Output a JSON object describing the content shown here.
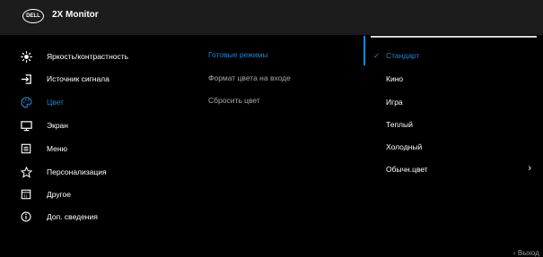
{
  "header": {
    "logo_text": "DELL",
    "title": "2X Monitor"
  },
  "menu": [
    {
      "label": "Яркость/контрастность",
      "icon": "brightness-icon"
    },
    {
      "label": "Источник сигнала",
      "icon": "input-source-icon"
    },
    {
      "label": "Цвет",
      "icon": "color-palette-icon"
    },
    {
      "label": "Экран",
      "icon": "display-icon"
    },
    {
      "label": "Меню",
      "icon": "menu-icon"
    },
    {
      "label": "Персонализация",
      "icon": "star-icon"
    },
    {
      "label": "Другое",
      "icon": "others-icon"
    },
    {
      "label": "Доп. сведения",
      "icon": "info-icon"
    }
  ],
  "selected_menu": "Цвет",
  "submenu": [
    {
      "label": "Готовые режимы"
    },
    {
      "label": "Формат цвета на входе"
    },
    {
      "label": "Сбросить цвет"
    }
  ],
  "options": [
    {
      "label": "Стандарт",
      "selected": true
    },
    {
      "label": "Кино"
    },
    {
      "label": "Игра"
    },
    {
      "label": "Теплый"
    },
    {
      "label": "Холодный"
    },
    {
      "label": "Обычн.цвет",
      "has_submenu": true
    }
  ],
  "footer": {
    "exit_label": "Выход"
  },
  "colors": {
    "accent": "#1a86d0",
    "header_bg": "#1c1c1c",
    "bg": "#000000",
    "dim_text": "#a8a8a8"
  }
}
